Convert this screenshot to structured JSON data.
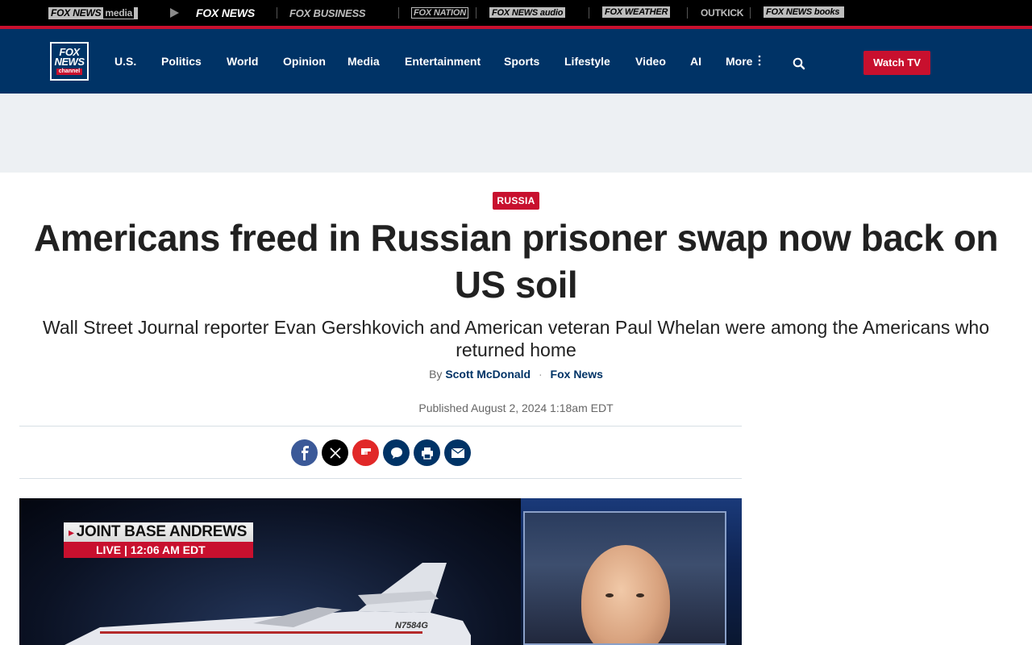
{
  "network_bar": {
    "items": [
      {
        "label": "FOX NEWS",
        "suffix": "media"
      },
      {
        "label": "FOX NEWS"
      },
      {
        "label": "FOX BUSINESS"
      },
      {
        "label": "FOX NATION"
      },
      {
        "label": "FOX NEWS audio"
      },
      {
        "label": "FOX WEATHER"
      },
      {
        "label": "OUTKICK"
      },
      {
        "label": "FOX NEWS books"
      }
    ]
  },
  "header": {
    "logo": {
      "line1": "FOX",
      "line2": "NEWS",
      "line3": "channel"
    },
    "nav": [
      "U.S.",
      "Politics",
      "World",
      "Opinion",
      "Media",
      "Entertainment",
      "Sports",
      "Lifestyle",
      "Video",
      "AI",
      "More"
    ],
    "watch_tv": "Watch TV"
  },
  "article": {
    "category": "RUSSIA",
    "headline": "Americans freed in Russian prisoner swap now back on US soil",
    "subheadline": "Wall Street Journal reporter Evan Gershkovich and American veteran Paul Whelan were among the Americans who returned home",
    "byline": {
      "prefix": "By",
      "author": "Scott McDonald",
      "dot": "·",
      "outlet": "Fox News"
    },
    "published": "Published August 2, 2024 1:18am EDT",
    "share": [
      "facebook",
      "x",
      "flipboard",
      "comments",
      "print",
      "email"
    ]
  },
  "video": {
    "lower_third_title": "JOINT BASE ANDREWS",
    "lower_third_status": "LIVE  |  12:06 AM EDT",
    "tail_number": "N7584G"
  },
  "colors": {
    "brand_blue": "#003366",
    "brand_red": "#c8102e",
    "ad_band": "#edf0f3"
  }
}
